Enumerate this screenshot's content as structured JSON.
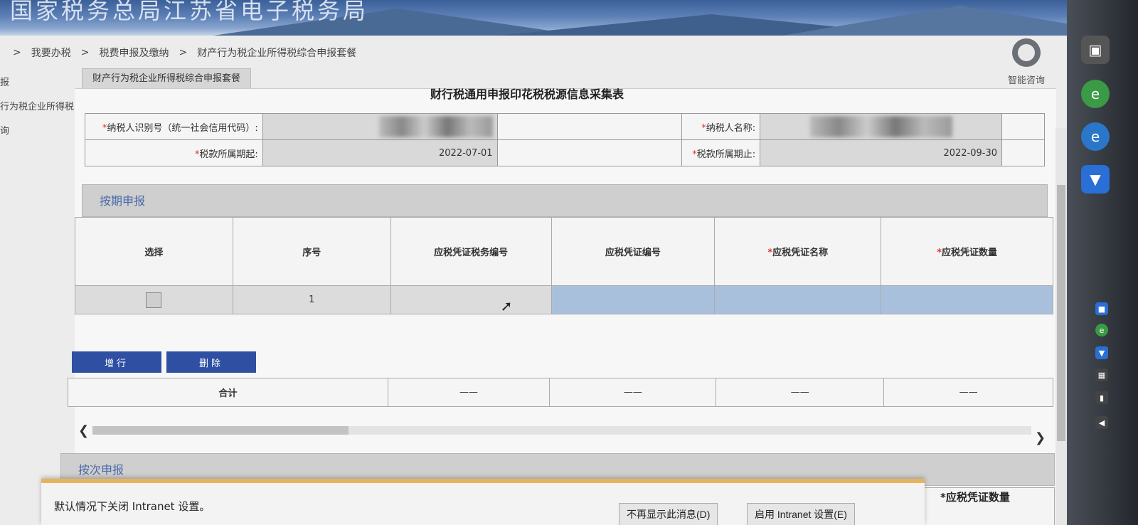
{
  "banner": {
    "title": "国家税务总局江苏省电子税务局"
  },
  "breadcrumb": [
    "我要办税",
    "税费申报及缴纳",
    "财产行为税企业所得税综合申报套餐"
  ],
  "breadcrumb_sep": ">",
  "sidebar": {
    "items": [
      "报",
      "行为税企业所得税",
      "询"
    ]
  },
  "help": {
    "label": "智能咨询"
  },
  "tab": {
    "label": "财产行为税企业所得税综合申报套餐"
  },
  "form": {
    "title": "财行税通用申报印花税税源信息采集表",
    "taxpayer_id_label": "纳税人识别号（统一社会信用代码）:",
    "taxpayer_name_label": "纳税人名称:",
    "period_start_label": "税款所属期起:",
    "period_start": "2022-07-01",
    "period_end_label": "税款所属期止:",
    "period_end": "2022-09-30",
    "req_mark": "*"
  },
  "section1": {
    "title": "按期申报",
    "columns": [
      "选择",
      "序号",
      "应税凭证税务编号",
      "应税凭证编号",
      "应税凭证名称",
      "应税凭证数量"
    ],
    "required_cols": [
      false,
      false,
      false,
      false,
      true,
      true
    ],
    "rows": [
      {
        "index": "1"
      }
    ],
    "add_button": "增行",
    "delete_button": "删除",
    "total_label": "合计",
    "total_placeholder": "——"
  },
  "section2": {
    "title": "按次申报"
  },
  "notice": {
    "text": "默认情况下关闭 Intranet 设置。",
    "btn_dont_show": "不再显示此消息(D)",
    "btn_enable": "启用 Intranet 设置(E)"
  },
  "right_label": "*应税凭证数量",
  "colors": {
    "accent": "#2f4fa3",
    "section_title": "#4a6aa8",
    "required": "#d33333",
    "selected_row": "#a9c0dd"
  },
  "icons": [
    "headset-icon",
    "scroll-left-icon",
    "scroll-right-icon",
    "checkbox-icon",
    "mouse-cursor-icon"
  ]
}
